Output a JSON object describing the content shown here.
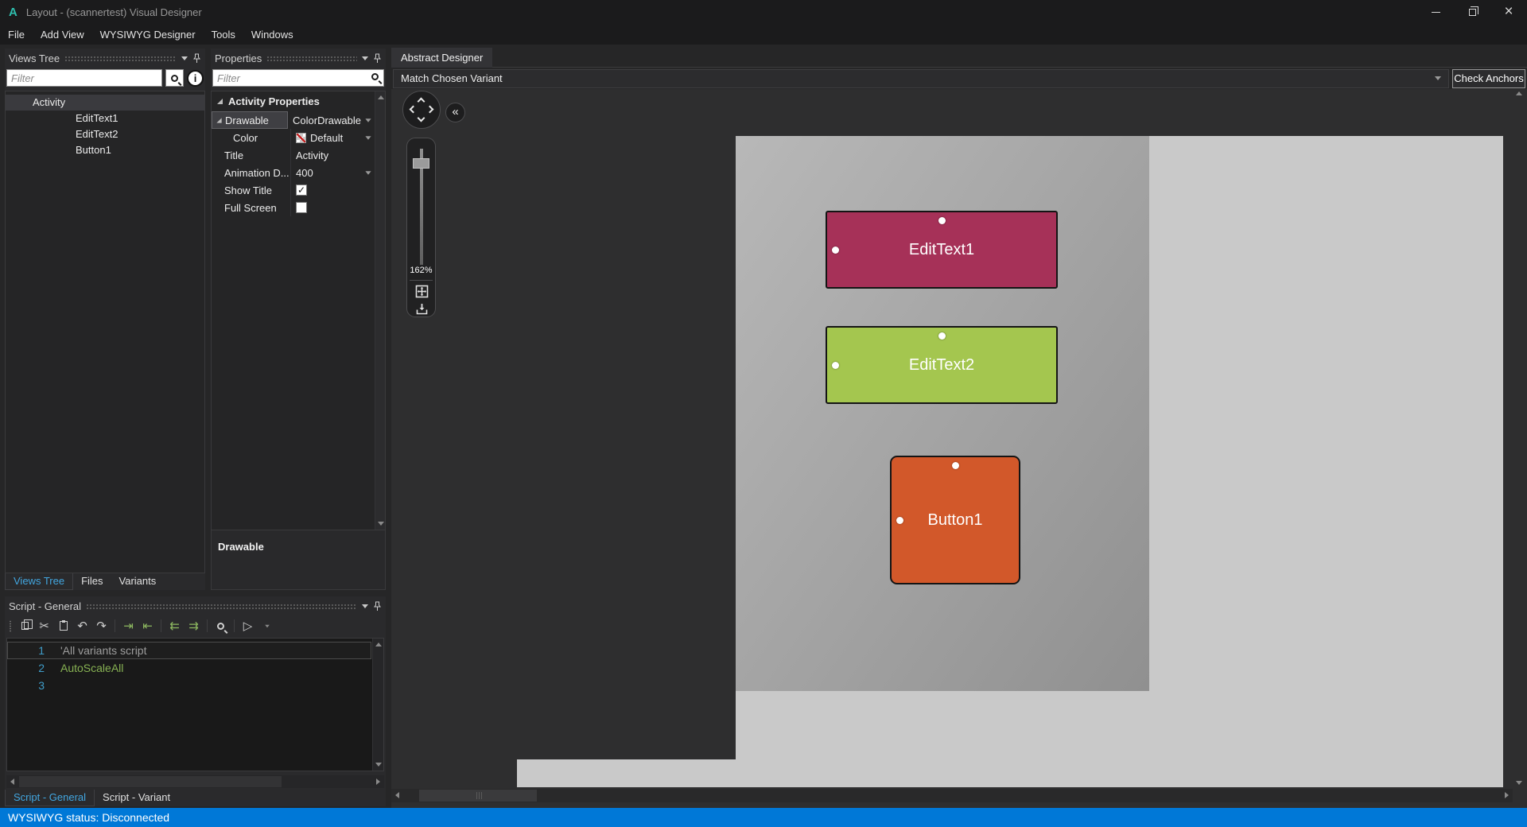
{
  "window": {
    "logo_text": "A",
    "title": "Layout - (scannertest) Visual Designer"
  },
  "icons": {
    "close": "×",
    "collapse": "«",
    "cut": "✂",
    "undo": "↶",
    "redo": "↷",
    "indent": "⇥",
    "outdent": "⇤",
    "shift_left": "⇇",
    "shift_right": "⇉",
    "run": "▷",
    "check": "✓"
  },
  "menu": {
    "items": [
      {
        "label": "File"
      },
      {
        "label": "Add View"
      },
      {
        "label": "WYSIWYG Designer"
      },
      {
        "label": "Tools"
      },
      {
        "label": "Windows"
      }
    ]
  },
  "views_tree": {
    "panel_title": "Views Tree",
    "filter_placeholder": "Filter",
    "items": [
      {
        "label": "Activity"
      },
      {
        "label": "EditText1"
      },
      {
        "label": "EditText2"
      },
      {
        "label": "Button1"
      }
    ],
    "tabs": [
      {
        "label": "Views Tree"
      },
      {
        "label": "Files"
      },
      {
        "label": "Variants"
      }
    ]
  },
  "properties": {
    "panel_title": "Properties",
    "filter_placeholder": "Filter",
    "category": "Activity Properties",
    "rows": [
      {
        "label": "Drawable",
        "value": "ColorDrawable"
      },
      {
        "label": "Color",
        "value": "Default"
      },
      {
        "label": "Title",
        "value": "Activity"
      },
      {
        "label": "Animation D...",
        "value": "400"
      },
      {
        "label": "Show Title",
        "value": "✓"
      },
      {
        "label": "Full Screen",
        "value": ""
      }
    ],
    "description_title": "Drawable"
  },
  "script": {
    "panel_title": "Script - General",
    "lines": [
      {
        "num": "1",
        "text": "'All variants script"
      },
      {
        "num": "2",
        "text": "AutoScaleAll"
      },
      {
        "num": "3",
        "text": ""
      }
    ],
    "tabs": [
      {
        "label": "Script - General"
      },
      {
        "label": "Script - Variant"
      }
    ]
  },
  "designer": {
    "doc_tab": "Abstract Designer",
    "variant_combo": "Match Chosen Variant",
    "check_anchors_label": "Check Anchors",
    "zoom_percent": "162%",
    "widgets": [
      {
        "label": "EditText1",
        "color": "#a63158"
      },
      {
        "label": "EditText2",
        "color": "#a4c64f"
      },
      {
        "label": "Button1",
        "color": "#d2582a"
      }
    ]
  },
  "status_bar": {
    "text": "WYSIWYG status: Disconnected",
    "color": "#0078d7"
  },
  "colors": {
    "accent_blue": "#42a6e0",
    "selection": "#3a3a3e"
  }
}
